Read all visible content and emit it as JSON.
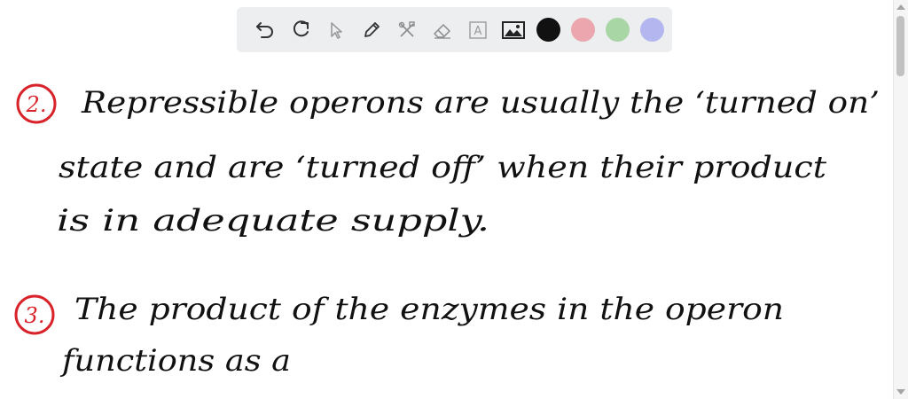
{
  "toolbar": {
    "tools": [
      {
        "name": "undo-icon"
      },
      {
        "name": "redo-icon"
      },
      {
        "name": "pointer-icon"
      },
      {
        "name": "pen-icon"
      },
      {
        "name": "tools-icon"
      },
      {
        "name": "eraser-icon"
      },
      {
        "name": "text-icon",
        "glyph": "A"
      },
      {
        "name": "image-icon"
      }
    ],
    "colors": [
      "#111111",
      "#eba7ad",
      "#a9d6a5",
      "#b4b7ef"
    ]
  },
  "notes": {
    "item2": {
      "number": "2.",
      "line1": "Repressible operons are usually the ‘turned on’",
      "line2": "state and are ‘turned off’ when their product",
      "line3": "is in adequate supply."
    },
    "item3": {
      "number": "3.",
      "line1": "The product of the enzymes in the operon",
      "line2": "functions as a"
    }
  },
  "colors": {
    "ink": "#111111",
    "marker": "#d8232a",
    "toolbar_bg": "#eceef0"
  }
}
